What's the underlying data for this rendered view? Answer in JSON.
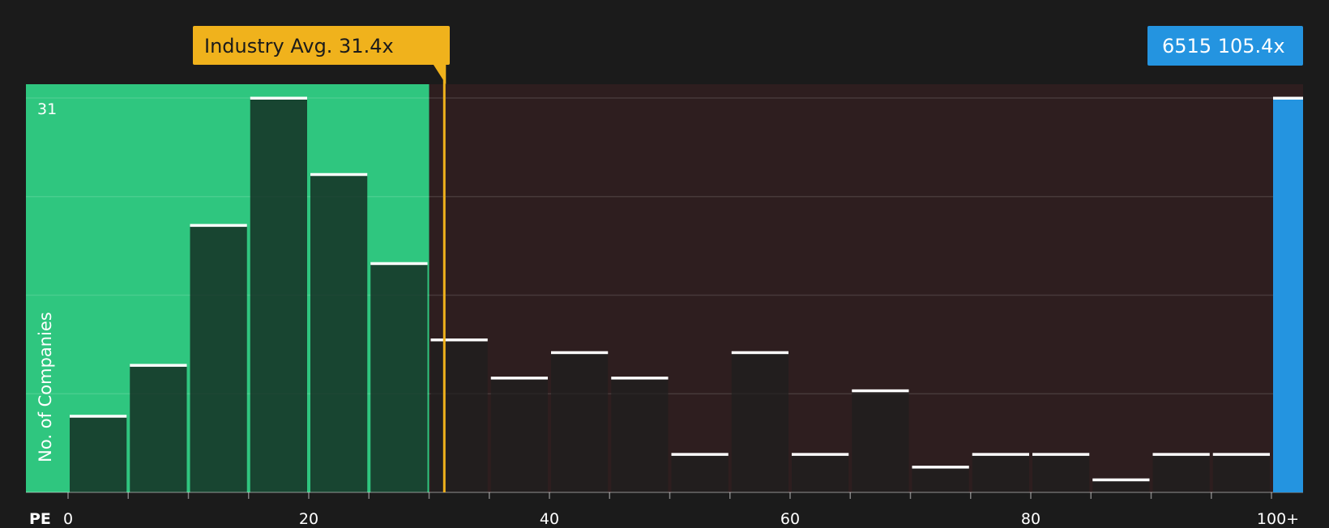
{
  "company_badge": {
    "ticker": "6515",
    "value": "105.4x"
  },
  "industry_badge": {
    "label": "Industry Avg. 31.4x"
  },
  "colors": {
    "background": "#1b1b1b",
    "below_avg_zone": "#2fc67f",
    "above_avg_zone": "#2e1e1f",
    "industry_line": "#f0b21c",
    "company_bar": "#2494e0"
  },
  "chart_data": {
    "type": "bar",
    "ylabel": "No. of Companies",
    "y_max_label": "31",
    "ylim": [
      0,
      31
    ],
    "xlabel": "PE",
    "x_ticks": [
      {
        "value": 0,
        "label": "0"
      },
      {
        "value": 20,
        "label": "20"
      },
      {
        "value": 40,
        "label": "40"
      },
      {
        "value": 60,
        "label": "60"
      },
      {
        "value": 80,
        "label": "80"
      },
      {
        "value": 100,
        "label": "100+"
      }
    ],
    "bin_width": 5,
    "bins": [
      {
        "start": 0,
        "count": 6
      },
      {
        "start": 5,
        "count": 10
      },
      {
        "start": 10,
        "count": 21
      },
      {
        "start": 15,
        "count": 31
      },
      {
        "start": 20,
        "count": 25
      },
      {
        "start": 25,
        "count": 18
      },
      {
        "start": 30,
        "count": 12
      },
      {
        "start": 35,
        "count": 9
      },
      {
        "start": 40,
        "count": 11
      },
      {
        "start": 45,
        "count": 9
      },
      {
        "start": 50,
        "count": 3
      },
      {
        "start": 55,
        "count": 11
      },
      {
        "start": 60,
        "count": 3
      },
      {
        "start": 65,
        "count": 8
      },
      {
        "start": 70,
        "count": 2
      },
      {
        "start": 75,
        "count": 3
      },
      {
        "start": 80,
        "count": 3
      },
      {
        "start": 85,
        "count": 1
      },
      {
        "start": 90,
        "count": 3
      },
      {
        "start": 95,
        "count": 3
      }
    ],
    "industry_average": 31.4,
    "company": {
      "ticker": "6515",
      "pe": 105.4,
      "count": 31
    },
    "grid": true
  }
}
